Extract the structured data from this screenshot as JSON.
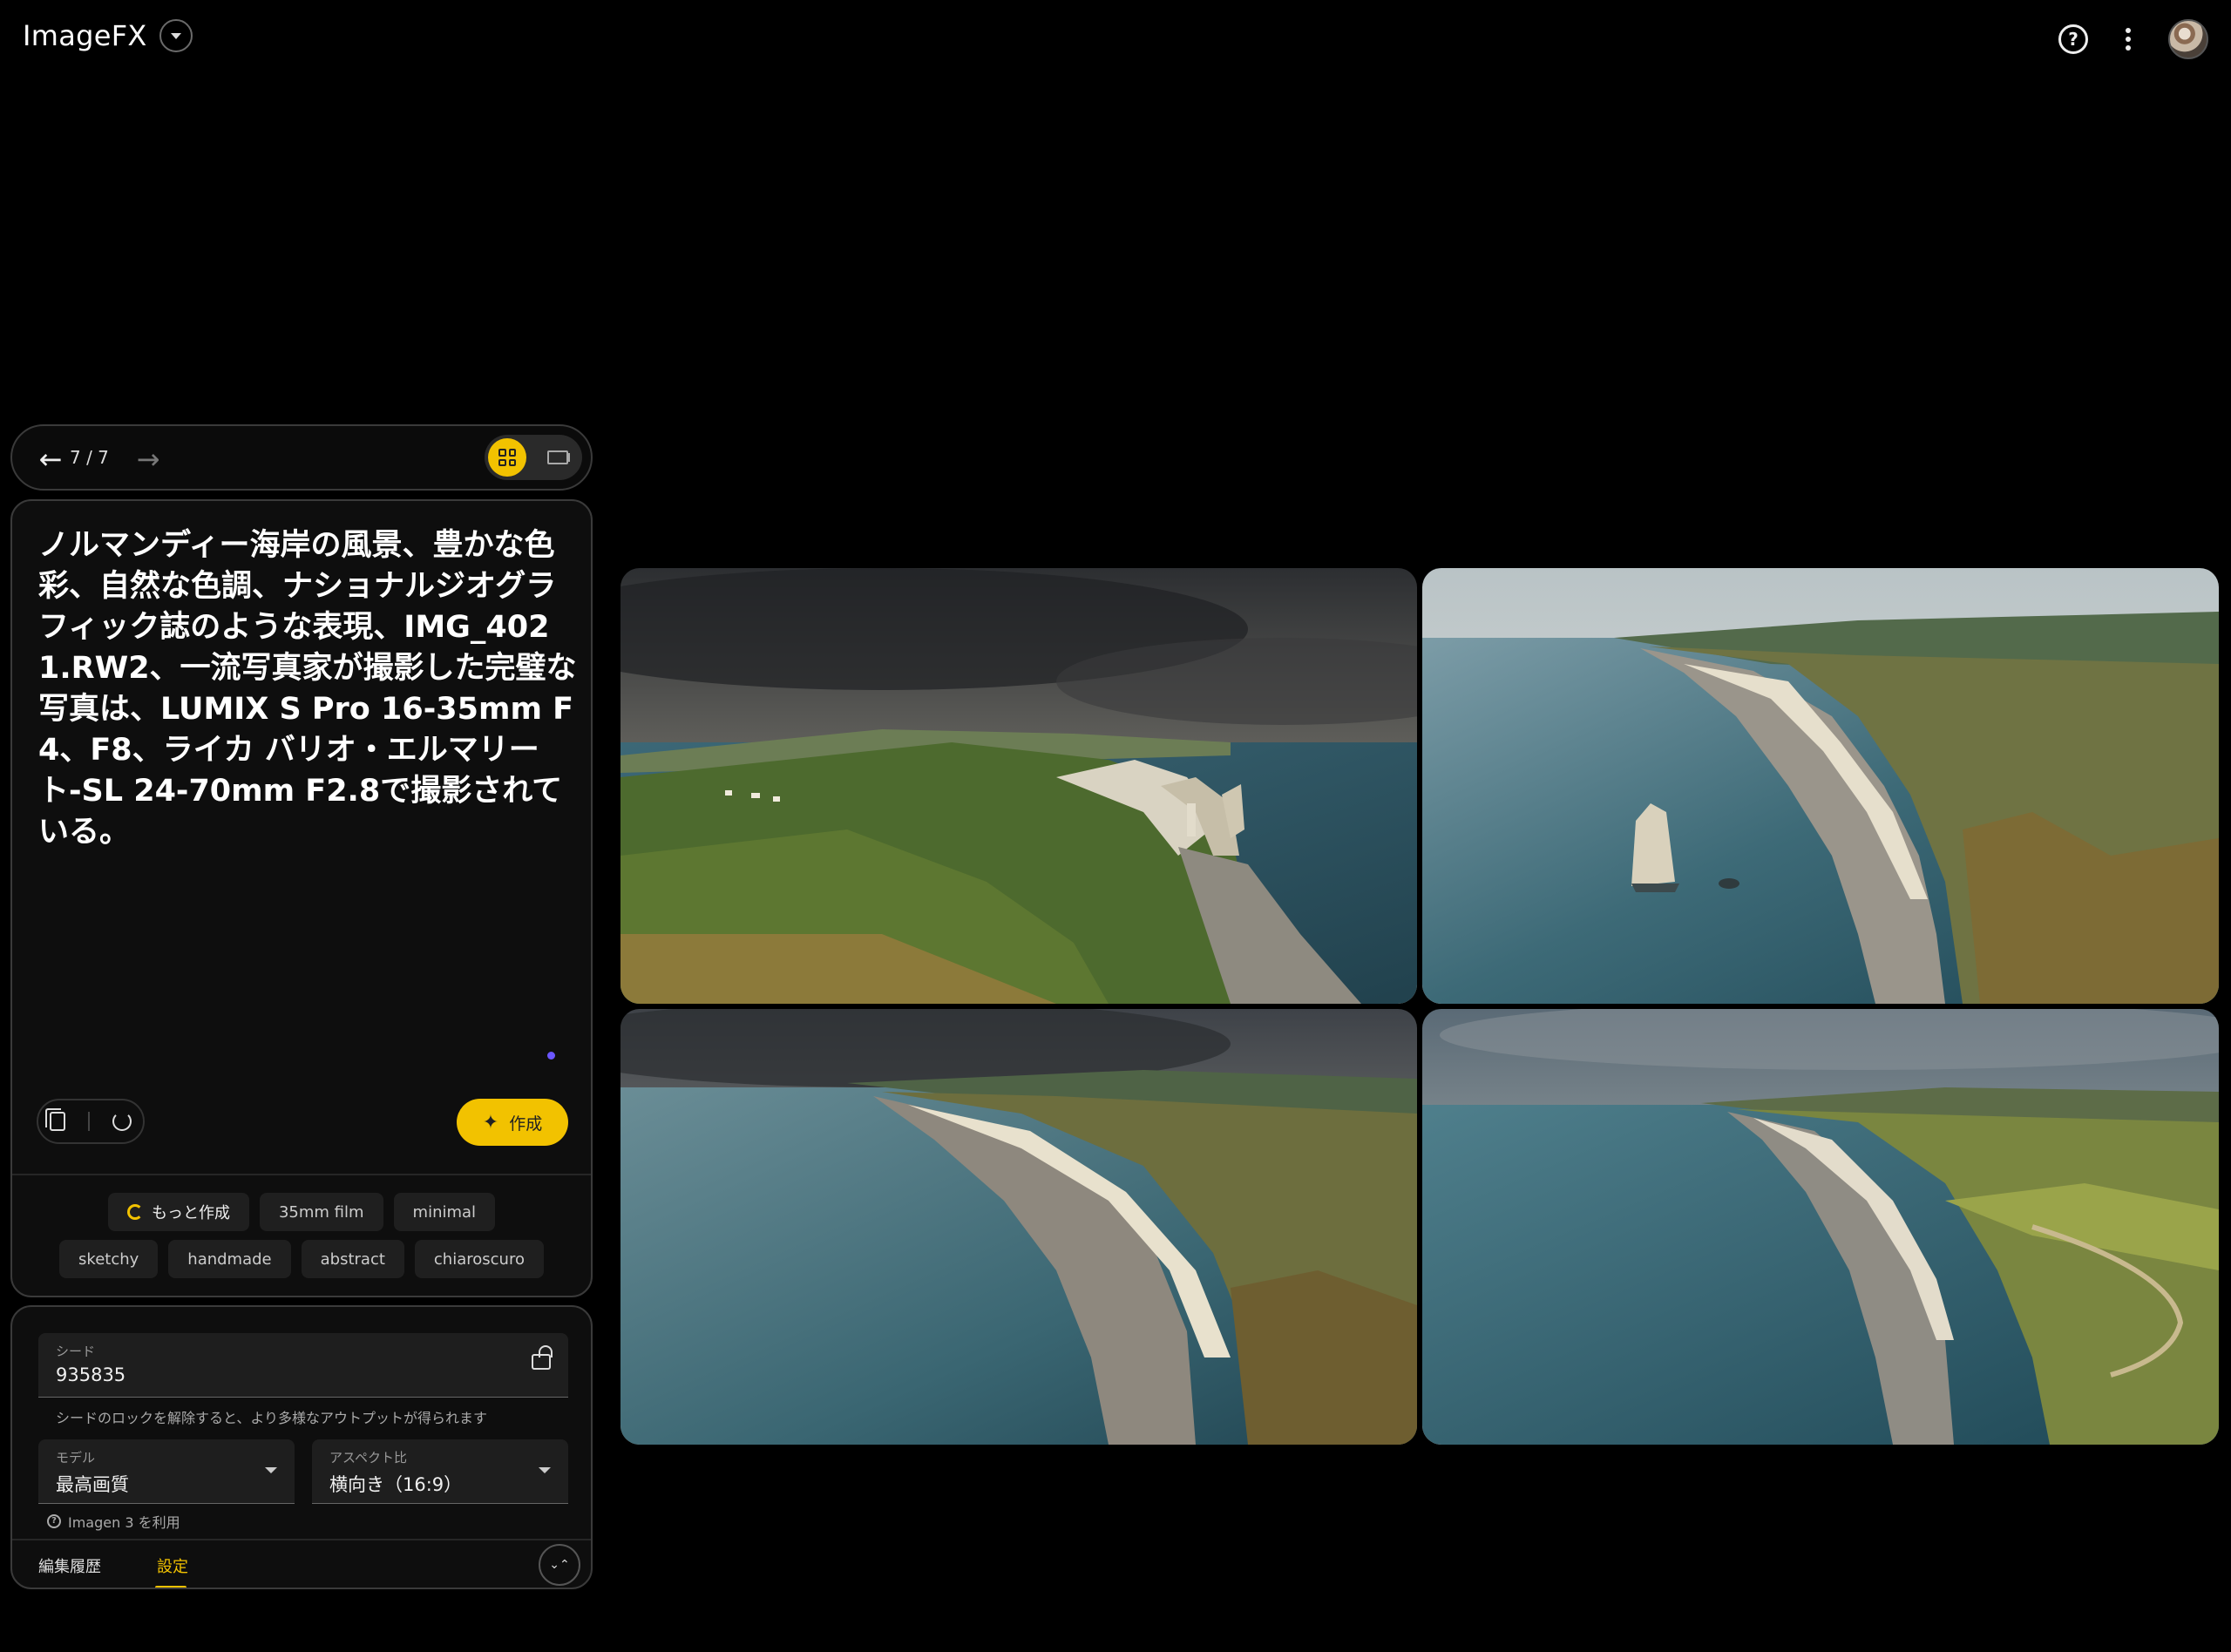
{
  "app": {
    "title": "ImageFX"
  },
  "header": {
    "menu_icon": "chevron-down-icon",
    "help_glyph": "?",
    "help_icon": "help-circle-icon",
    "more_icon": "more-vert-icon",
    "avatar_icon": "user-avatar"
  },
  "nav": {
    "back_glyph": "←",
    "forward_glyph": "→",
    "counter": "7 / 7",
    "grid_view_icon": "grid-view-icon",
    "single_view_icon": "single-view-icon"
  },
  "prompt": {
    "text": "ノルマンディー海岸の風景、豊かな色彩、自然な色調、ナショナルジオグラフィック誌のような表現、IMG_4021.RW2、一流写真家が撮影した完璧な写真は、LUMIX S Pro 16-35mm F4、F8、ライカ バリオ・エルマリート-SL 24-70mm F2.8で撮影されている。",
    "create_label": "作成",
    "create_glyph": "✦"
  },
  "chips": {
    "more_label": "もっと作成",
    "items": [
      "35mm film",
      "minimal",
      "sketchy",
      "handmade",
      "abstract",
      "chiaroscuro"
    ]
  },
  "settings": {
    "seed_label": "シード",
    "seed_value": "935835",
    "seed_hint": "シードのロックを解除すると、より多様なアウトプットが得られます",
    "model_label": "モデル",
    "model_value": "最高画質",
    "aspect_label": "アスペクト比",
    "aspect_value": "横向き（16:9）",
    "imagen_note": "Imagen 3 を利用",
    "info_glyph": "?",
    "tab_history": "編集履歴",
    "tab_settings": "設定",
    "collapse_glyph": "⌄⌃"
  },
  "gallery": {
    "images": [
      "normandy-cliff-arch-image",
      "white-cliffs-sea-stack-image",
      "curving-beach-cliffs-image",
      "coastline-cliff-path-image"
    ]
  },
  "colors": {
    "accent": "#f2c200",
    "background": "#000000",
    "card": "#0e0e0e",
    "border": "#3a3a3a",
    "dot": "#6b56ff"
  }
}
